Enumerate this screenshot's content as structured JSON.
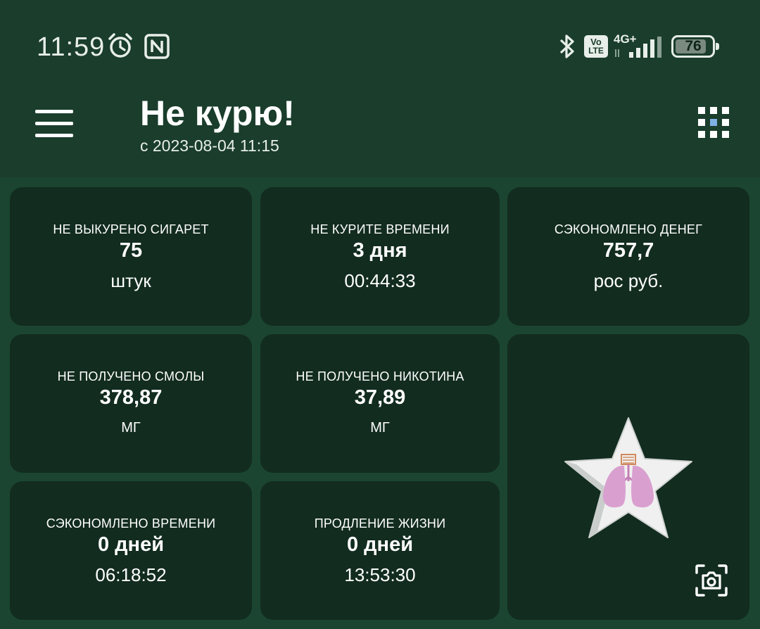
{
  "status_bar": {
    "time": "11:59",
    "icons": [
      "alarm-icon",
      "nfc-icon",
      "bluetooth-icon",
      "volte-icon",
      "signal-4g-icon",
      "battery-icon"
    ],
    "network": "4G+",
    "volte": [
      "Vo",
      "LTE"
    ],
    "battery_level": "76"
  },
  "app_bar": {
    "title": "Не курю!",
    "subtitle": "с 2023-08-04 11:15",
    "menu_icon": "hamburger-menu-icon",
    "grid_icon": "grid-menu-icon"
  },
  "cards": {
    "cigarettes": {
      "label": "НЕ ВЫКУРЕНО СИГАРЕТ",
      "value": "75",
      "unit": "штук"
    },
    "time_free": {
      "label": "НЕ КУРИТЕ ВРЕМЕНИ",
      "value": "3 дня",
      "unit": "00:44:33"
    },
    "money": {
      "label": "СЭКОНОМЛЕНО ДЕНЕГ",
      "value": "757,7",
      "unit": "рос руб."
    },
    "tar": {
      "label": "НЕ ПОЛУЧЕНО СМОЛЫ",
      "value": "378,87",
      "unit": "МГ"
    },
    "nicotine": {
      "label": "НЕ ПОЛУЧЕНО НИКОТИНА",
      "value": "37,89",
      "unit": "МГ"
    },
    "time_saved": {
      "label": "СЭКОНОМЛЕНО ВРЕМЕНИ",
      "value": "0 дней",
      "unit": "06:18:52"
    },
    "life": {
      "label": "ПРОДЛЕНИЕ ЖИЗНИ",
      "value": "0 дней",
      "unit": "13:53:30"
    }
  },
  "achievement": {
    "icon": "star-lungs-icon",
    "camera_icon": "screenshot-camera-icon"
  },
  "colors": {
    "background": "#1b4530",
    "top_bar": "#1a3d2c",
    "card": "#122c1f",
    "lungs": "#d9a0cf",
    "star": "#f0f0f0"
  }
}
